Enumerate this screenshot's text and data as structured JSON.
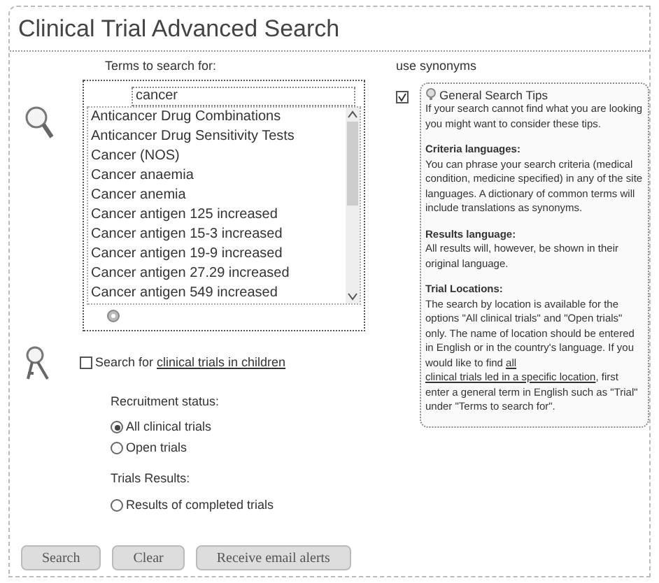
{
  "title": "Clinical Trial Advanced Search",
  "terms": {
    "label": "Terms to search for:",
    "value": "cancer",
    "items": [
      {
        "label": "Anticancer Drug Combinations",
        "selected": false
      },
      {
        "label": "Anticancer Drug Sensitivity Tests",
        "selected": false
      },
      {
        "label": "Cancer (NOS)",
        "selected": false
      },
      {
        "label": "Cancer anaemia",
        "selected": false
      },
      {
        "label": "Cancer anemia",
        "selected": false
      },
      {
        "label": "Cancer antigen 125 increased",
        "selected": false
      },
      {
        "label": "Cancer antigen 15-3 increased",
        "selected": false
      },
      {
        "label": "Cancer antigen 19-9 increased",
        "selected": false
      },
      {
        "label": "Cancer antigen 27.29 increased",
        "selected": false
      },
      {
        "label": "Cancer antigen 549 increased",
        "selected": false
      }
    ]
  },
  "children_search": {
    "prefix": "Search for ",
    "link": "clinical trials in children",
    "checked": false
  },
  "recruitment": {
    "label": "Recruitment status:",
    "options": [
      {
        "label": "All clinical trials",
        "selected": true
      },
      {
        "label": "Open trials",
        "selected": false
      }
    ]
  },
  "results": {
    "label": "Trials Results:",
    "options": [
      {
        "label": "Results of completed trials",
        "selected": false
      }
    ]
  },
  "synonyms": {
    "label": "use synonyms",
    "checked": true
  },
  "tips": {
    "title": "General Search Tips",
    "sections": [
      {
        "parts": [
          {
            "kind": "text",
            "text": "If your search cannot find what you are looking you might want to consider these tips."
          }
        ]
      },
      {
        "heading": "Criteria languages:",
        "parts": [
          {
            "kind": "text",
            "text": "You can phrase your search criteria (medical condition, medicine specified) in any of the site languages. A dictionary of common terms will include translations as synonyms."
          }
        ]
      },
      {
        "heading": "Results language:",
        "parts": [
          {
            "kind": "text",
            "text": "All results will, however, be shown in their original language."
          }
        ]
      },
      {
        "heading": "Trial Locations:",
        "parts": [
          {
            "kind": "text",
            "text": "The search by location is available for the options \"All clinical trials\" and \"Open trials\" only. The name of location should be entered in English or in the country's language. If you would like to find "
          },
          {
            "kind": "link",
            "text": "all"
          },
          {
            "kind": "link",
            "text": "clinical trials led in a specific location"
          },
          {
            "kind": "text",
            "text": ", first enter a general term in English such as \"Trial\" under \"Terms to search for\"."
          }
        ]
      }
    ]
  },
  "buttons": [
    "Search",
    "Clear",
    "Receive email alerts"
  ]
}
